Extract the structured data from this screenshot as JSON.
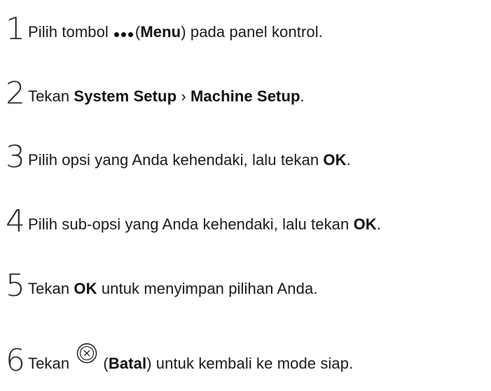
{
  "steps": [
    {
      "number": "1",
      "pre": "Pilih tombol",
      "open": "(",
      "bold": "Menu",
      "close": ")",
      "post": " pada panel kontrol.",
      "icon": "menu-dots-icon"
    },
    {
      "number": "2",
      "pre": "Tekan ",
      "bold1": "System Setup",
      "sep": " › ",
      "bold2": "Machine Setup",
      "post": "."
    },
    {
      "number": "3",
      "pre": "Pilih opsi yang Anda kehendaki, lalu tekan ",
      "bold": "OK",
      "post": "."
    },
    {
      "number": "4",
      "pre": "Pilih sub-opsi yang Anda kehendaki, lalu tekan ",
      "bold": "OK",
      "post": "."
    },
    {
      "number": "5",
      "pre": "Tekan ",
      "bold": "OK",
      "post": " untuk menyimpan pilihan Anda."
    },
    {
      "number": "6",
      "pre": "Tekan",
      "open": " (",
      "bold": "Batal",
      "post": ") untuk kembali ke mode siap.",
      "icon": "cancel-x-icon"
    }
  ]
}
